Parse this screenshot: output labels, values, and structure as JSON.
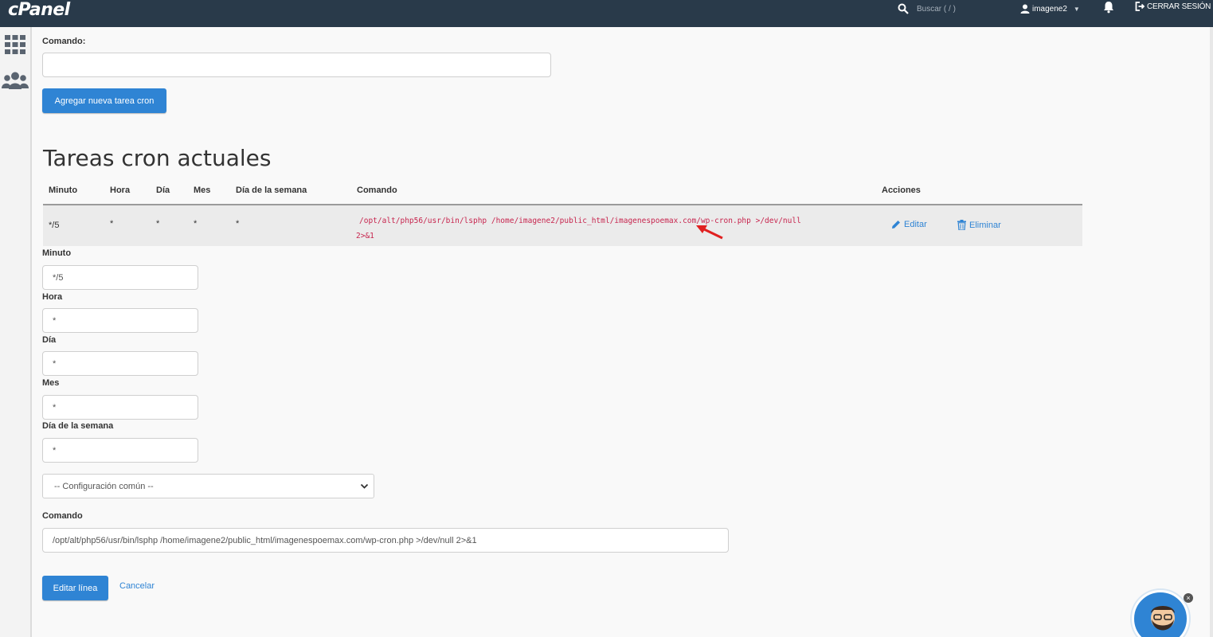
{
  "topbar": {
    "logo": "cPanel",
    "search_placeholder": "Buscar ( / )",
    "username": "imagene2",
    "logout_label": "CERRAR SESIÓN"
  },
  "add_form": {
    "command_label": "Comando:",
    "command_value": "",
    "add_button": "Agregar nueva tarea cron"
  },
  "current_jobs": {
    "heading": "Tareas cron actuales",
    "columns": [
      "Minuto",
      "Hora",
      "Día",
      "Mes",
      "Día de la semana",
      "Comando",
      "Acciones"
    ],
    "rows": [
      {
        "minute": "*/5",
        "hour": "*",
        "day": "*",
        "month": "*",
        "weekday": "*",
        "command_line1": "/opt/alt/php56/usr/bin/lsphp /home/imagene2/public_html/imagenespoemax.com/wp-cron.php >/dev/null",
        "command_line2": "2>&1",
        "edit_label": "Editar",
        "delete_label": "Eliminar"
      }
    ]
  },
  "edit_form": {
    "minute_label": "Minuto",
    "minute_value": "*/5",
    "hour_label": "Hora",
    "hour_value": "*",
    "day_label": "Día",
    "day_value": "*",
    "month_label": "Mes",
    "month_value": "*",
    "weekday_label": "Día de la semana",
    "weekday_value": "*",
    "common_settings": "-- Configuración común --",
    "command_label": "Comando",
    "command_value": "/opt/alt/php56/usr/bin/lsphp /home/imagene2/public_html/imagenespoemax.com/wp-cron.php >/dev/null 2>&1",
    "save_button": "Editar línea",
    "cancel_link": "Cancelar"
  },
  "colors": {
    "topbar": "#293a4a",
    "accent": "#2f84d4",
    "command_text": "#c7254e",
    "annotation_arrow": "#e02020"
  },
  "icons": [
    "search-icon",
    "user-icon",
    "chevron-down-icon",
    "bell-icon",
    "logout-icon",
    "grid-icon",
    "users-icon",
    "pencil-icon",
    "trash-icon",
    "red-arrow-annotation",
    "support-avatar-icon",
    "close-icon"
  ]
}
